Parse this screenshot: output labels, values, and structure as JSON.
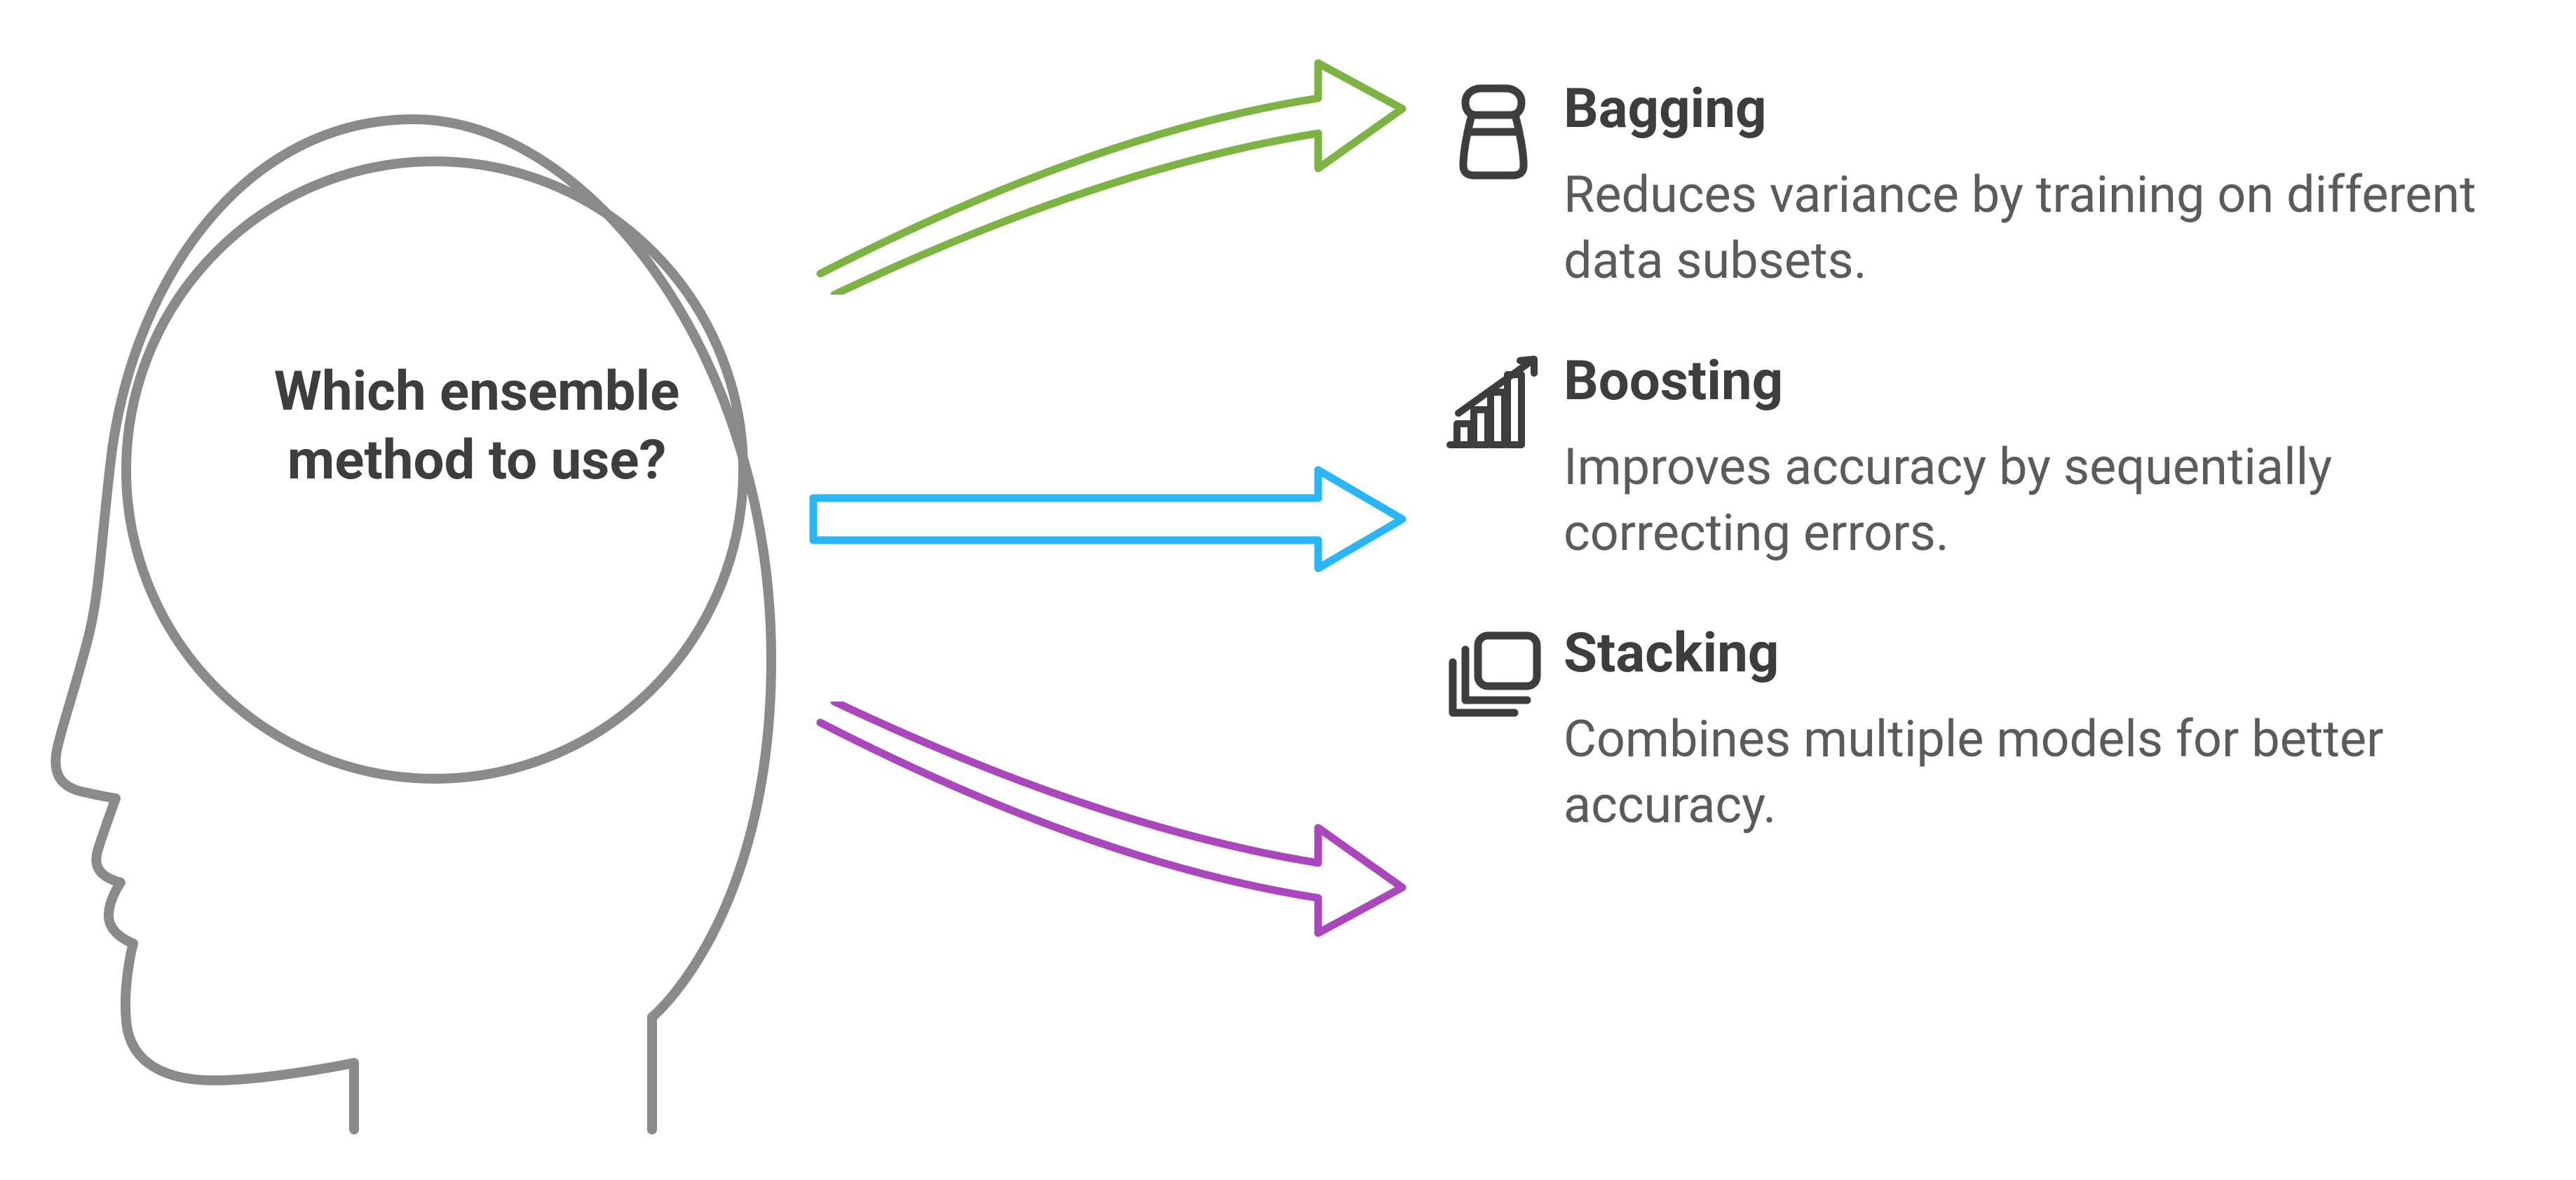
{
  "question": "Which ensemble method to use?",
  "methods": [
    {
      "title": "Bagging",
      "description": "Reduces variance by training on different data subsets.",
      "icon": "salt-shaker-icon",
      "arrow_color": "#7cb342"
    },
    {
      "title": "Boosting",
      "description": "Improves accuracy by sequentially correcting errors.",
      "icon": "bar-growth-icon",
      "arrow_color": "#29b6f6"
    },
    {
      "title": "Stacking",
      "description": "Combines multiple models for better accuracy.",
      "icon": "stack-icon",
      "arrow_color": "#ab47bc"
    }
  ],
  "colors": {
    "outline": "#8a8a8a",
    "text_heading": "#3d3d3d",
    "text_body": "#5b5b5b",
    "arrow_green": "#7cb342",
    "arrow_blue": "#29b6f6",
    "arrow_purple": "#ab47bc"
  }
}
